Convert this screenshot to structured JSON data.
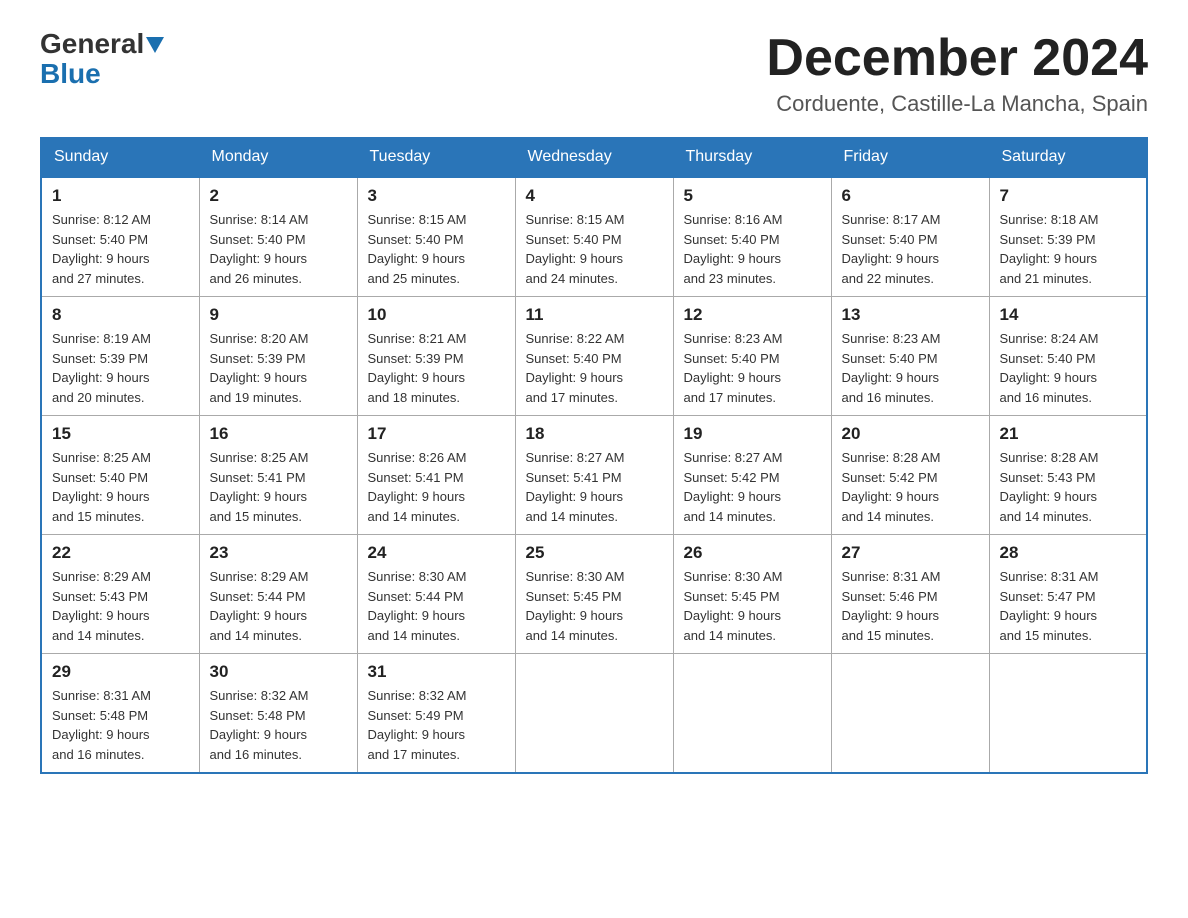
{
  "header": {
    "logo_general": "General",
    "logo_blue": "Blue",
    "month_title": "December 2024",
    "location": "Corduente, Castille-La Mancha, Spain"
  },
  "days_of_week": [
    "Sunday",
    "Monday",
    "Tuesday",
    "Wednesday",
    "Thursday",
    "Friday",
    "Saturday"
  ],
  "weeks": [
    [
      {
        "day": "1",
        "sunrise": "8:12 AM",
        "sunset": "5:40 PM",
        "daylight": "9 hours and 27 minutes."
      },
      {
        "day": "2",
        "sunrise": "8:14 AM",
        "sunset": "5:40 PM",
        "daylight": "9 hours and 26 minutes."
      },
      {
        "day": "3",
        "sunrise": "8:15 AM",
        "sunset": "5:40 PM",
        "daylight": "9 hours and 25 minutes."
      },
      {
        "day": "4",
        "sunrise": "8:15 AM",
        "sunset": "5:40 PM",
        "daylight": "9 hours and 24 minutes."
      },
      {
        "day": "5",
        "sunrise": "8:16 AM",
        "sunset": "5:40 PM",
        "daylight": "9 hours and 23 minutes."
      },
      {
        "day": "6",
        "sunrise": "8:17 AM",
        "sunset": "5:40 PM",
        "daylight": "9 hours and 22 minutes."
      },
      {
        "day": "7",
        "sunrise": "8:18 AM",
        "sunset": "5:39 PM",
        "daylight": "9 hours and 21 minutes."
      }
    ],
    [
      {
        "day": "8",
        "sunrise": "8:19 AM",
        "sunset": "5:39 PM",
        "daylight": "9 hours and 20 minutes."
      },
      {
        "day": "9",
        "sunrise": "8:20 AM",
        "sunset": "5:39 PM",
        "daylight": "9 hours and 19 minutes."
      },
      {
        "day": "10",
        "sunrise": "8:21 AM",
        "sunset": "5:39 PM",
        "daylight": "9 hours and 18 minutes."
      },
      {
        "day": "11",
        "sunrise": "8:22 AM",
        "sunset": "5:40 PM",
        "daylight": "9 hours and 17 minutes."
      },
      {
        "day": "12",
        "sunrise": "8:23 AM",
        "sunset": "5:40 PM",
        "daylight": "9 hours and 17 minutes."
      },
      {
        "day": "13",
        "sunrise": "8:23 AM",
        "sunset": "5:40 PM",
        "daylight": "9 hours and 16 minutes."
      },
      {
        "day": "14",
        "sunrise": "8:24 AM",
        "sunset": "5:40 PM",
        "daylight": "9 hours and 16 minutes."
      }
    ],
    [
      {
        "day": "15",
        "sunrise": "8:25 AM",
        "sunset": "5:40 PM",
        "daylight": "9 hours and 15 minutes."
      },
      {
        "day": "16",
        "sunrise": "8:25 AM",
        "sunset": "5:41 PM",
        "daylight": "9 hours and 15 minutes."
      },
      {
        "day": "17",
        "sunrise": "8:26 AM",
        "sunset": "5:41 PM",
        "daylight": "9 hours and 14 minutes."
      },
      {
        "day": "18",
        "sunrise": "8:27 AM",
        "sunset": "5:41 PM",
        "daylight": "9 hours and 14 minutes."
      },
      {
        "day": "19",
        "sunrise": "8:27 AM",
        "sunset": "5:42 PM",
        "daylight": "9 hours and 14 minutes."
      },
      {
        "day": "20",
        "sunrise": "8:28 AM",
        "sunset": "5:42 PM",
        "daylight": "9 hours and 14 minutes."
      },
      {
        "day": "21",
        "sunrise": "8:28 AM",
        "sunset": "5:43 PM",
        "daylight": "9 hours and 14 minutes."
      }
    ],
    [
      {
        "day": "22",
        "sunrise": "8:29 AM",
        "sunset": "5:43 PM",
        "daylight": "9 hours and 14 minutes."
      },
      {
        "day": "23",
        "sunrise": "8:29 AM",
        "sunset": "5:44 PM",
        "daylight": "9 hours and 14 minutes."
      },
      {
        "day": "24",
        "sunrise": "8:30 AM",
        "sunset": "5:44 PM",
        "daylight": "9 hours and 14 minutes."
      },
      {
        "day": "25",
        "sunrise": "8:30 AM",
        "sunset": "5:45 PM",
        "daylight": "9 hours and 14 minutes."
      },
      {
        "day": "26",
        "sunrise": "8:30 AM",
        "sunset": "5:45 PM",
        "daylight": "9 hours and 14 minutes."
      },
      {
        "day": "27",
        "sunrise": "8:31 AM",
        "sunset": "5:46 PM",
        "daylight": "9 hours and 15 minutes."
      },
      {
        "day": "28",
        "sunrise": "8:31 AM",
        "sunset": "5:47 PM",
        "daylight": "9 hours and 15 minutes."
      }
    ],
    [
      {
        "day": "29",
        "sunrise": "8:31 AM",
        "sunset": "5:48 PM",
        "daylight": "9 hours and 16 minutes."
      },
      {
        "day": "30",
        "sunrise": "8:32 AM",
        "sunset": "5:48 PM",
        "daylight": "9 hours and 16 minutes."
      },
      {
        "day": "31",
        "sunrise": "8:32 AM",
        "sunset": "5:49 PM",
        "daylight": "9 hours and 17 minutes."
      },
      null,
      null,
      null,
      null
    ]
  ],
  "labels": {
    "sunrise": "Sunrise:",
    "sunset": "Sunset:",
    "daylight": "Daylight:"
  }
}
